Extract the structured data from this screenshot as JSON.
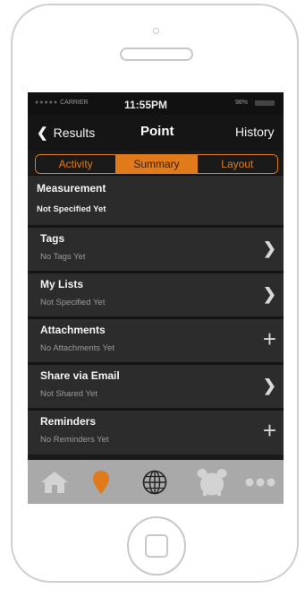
{
  "status": {
    "carrier": "CARRIER",
    "time": "11:55PM",
    "battery": "98%"
  },
  "nav": {
    "back_label": "Results",
    "title": "Point",
    "right_label": "History"
  },
  "segments": [
    {
      "label": "Activity",
      "active": false
    },
    {
      "label": "Summary",
      "active": true
    },
    {
      "label": "Layout",
      "active": false
    }
  ],
  "measurement": {
    "label": "Measurement",
    "value": "Not Specified Yet"
  },
  "rows": [
    {
      "label": "Tags",
      "value": "No Tags Yet",
      "accessory": "chevron-right-icon"
    },
    {
      "label": "My Lists",
      "value": "Not Specified Yet",
      "accessory": "chevron-right-icon"
    },
    {
      "label": "Attachments",
      "value": "No Attachments Yet",
      "accessory": "plus-icon"
    },
    {
      "label": "Share via Email",
      "value": "Not Shared Yet",
      "accessory": "chevron-right-icon"
    },
    {
      "label": "Reminders",
      "value": "No Reminders Yet",
      "accessory": "plus-icon"
    }
  ],
  "tabbar": {
    "items": [
      {
        "icon": "home-icon",
        "active": false
      },
      {
        "icon": "location-pin-icon",
        "active": true
      },
      {
        "icon": "globe-icon",
        "active": false
      },
      {
        "icon": "alarm-clock-icon",
        "active": false
      },
      {
        "icon": "more-icon",
        "active": false
      }
    ]
  },
  "colors": {
    "accent": "#e07a1a",
    "tabbar_bg": "#a9a9a9",
    "tab_icon": "#d3d3d3"
  }
}
